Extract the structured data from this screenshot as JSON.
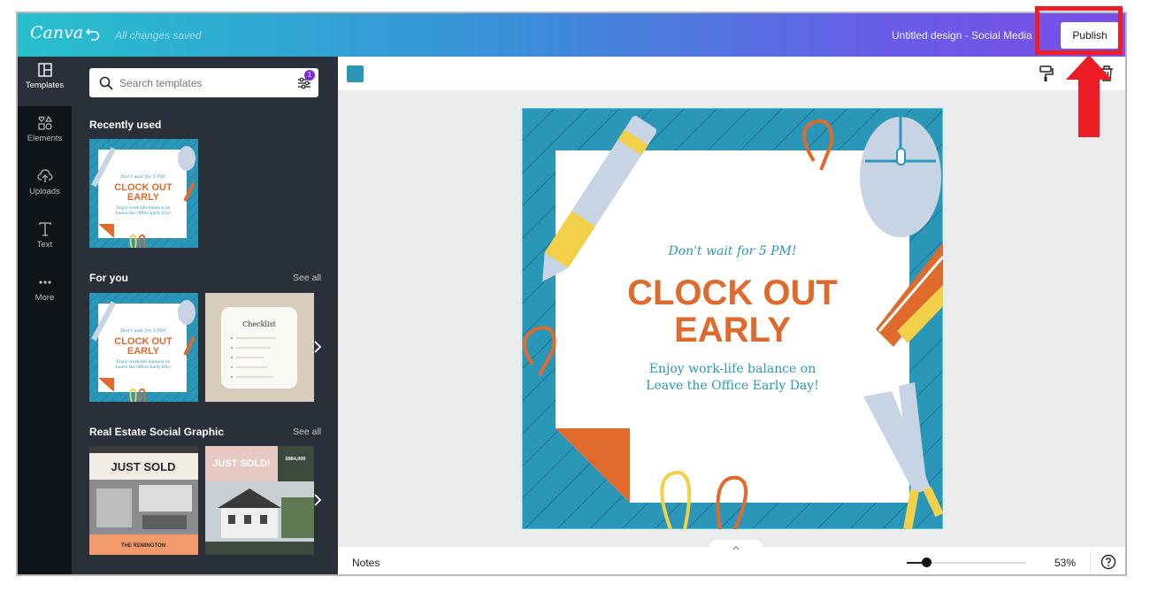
{
  "header": {
    "logo_text": "Canva",
    "save_status": "All changes saved",
    "doc_title": "Untitled design - Social Media",
    "publish_label": "Publish"
  },
  "sidebar": {
    "items": [
      {
        "label": "Templates",
        "icon": "templates-icon"
      },
      {
        "label": "Elements",
        "icon": "elements-icon"
      },
      {
        "label": "Uploads",
        "icon": "upload-icon"
      },
      {
        "label": "Text",
        "icon": "text-icon"
      },
      {
        "label": "More",
        "icon": "more-icon"
      }
    ]
  },
  "panel": {
    "search_placeholder": "Search templates",
    "filter_badge": "1",
    "sections": [
      {
        "title": "Recently used"
      },
      {
        "title": "For you",
        "see_all": "See all"
      },
      {
        "title": "Real Estate Social Graphic",
        "see_all": "See all"
      }
    ]
  },
  "templates": {
    "clock_small": {
      "line1": "Don't wait for 5 PM!",
      "title1": "CLOCK OUT",
      "title2": "EARLY",
      "sub1": "Enjoy work-life balance on",
      "sub2": "Leave the Office Early Day!"
    },
    "checklist_title": "Checklist",
    "just_sold_1": "JUST SOLD",
    "just_sold_1_footer": "THE REMINGTON",
    "just_sold_2": "JUST SOLD!",
    "just_sold_2_price": "$984,000"
  },
  "design": {
    "tagline": "Don't wait for 5 PM!",
    "headline1": "CLOCK OUT",
    "headline2": "EARLY",
    "body1": "Enjoy work-life balance on",
    "body2": "Leave the Office Early Day!"
  },
  "footer": {
    "notes_label": "Notes",
    "zoom_value": "53%",
    "zoom_fraction": 0.53,
    "help_icon": "help-icon"
  },
  "colors": {
    "teal_bg": "#2a97b9",
    "orange": "#e06a2c",
    "yellow": "#f2d04a",
    "highlight": "#ee1c24",
    "brand_purple": "#7d2ae8"
  }
}
